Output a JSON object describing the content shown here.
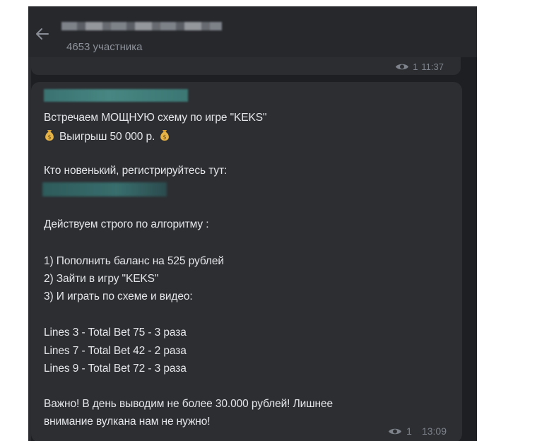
{
  "header": {
    "members": "4653 участника"
  },
  "previous_message": {
    "views": "1",
    "time": "11:37"
  },
  "message": {
    "lines": [
      "Встречаем МОЩНУЮ схему по игре \"KEKS\"",
      "Выигрыш 50 000 р.",
      "Кто новенький,  регистрируйтесь тут:",
      "Действуем строго по алгоритму :",
      "1) Пополнить баланс на 525 рублей",
      "2) Зайти в игру \"KEKS\"",
      "3) И играть по схеме и видео:",
      "Lines 3 - Total Bet 75 - 3 раза",
      "Lines 7 - Total Bet 42 - 2  раза",
      "Lines 9 - Total Bet 72 - 3  раза",
      "Важно! В день выводим не более 30.000 рублей!  Лишнее",
      "внимание вулкана нам не нужно!"
    ],
    "views": "1",
    "time": "13:09"
  },
  "icons": {
    "back": "arrow-left-icon",
    "bag": "money-bag-icon",
    "views": "eye-icon"
  },
  "colors": {
    "background": "#1e1f23",
    "bubble": "#2c2e32",
    "header": "#26282c",
    "text": "#e4e6ea",
    "muted": "#8d929a"
  }
}
